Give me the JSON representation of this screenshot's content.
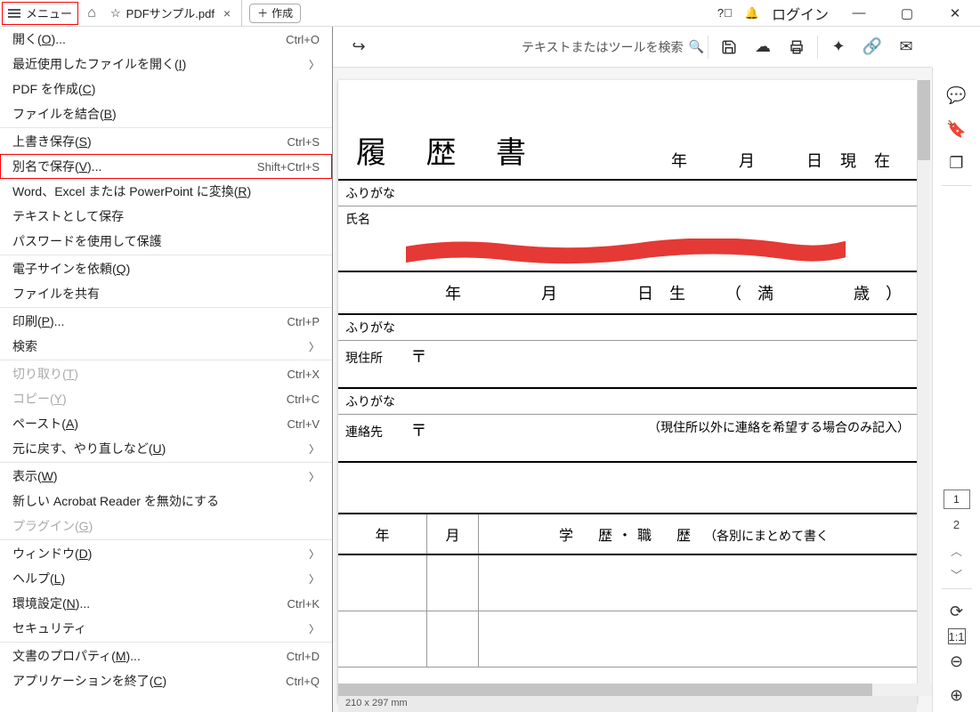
{
  "titlebar": {
    "menu": "メニュー",
    "tab_title": "PDFサンプル.pdf",
    "create": "作成",
    "login": "ログイン"
  },
  "callouts": {
    "one": "1",
    "two": "2"
  },
  "menu": {
    "open": "開く(O)...",
    "open_sc": "Ctrl+O",
    "recent": "最近使用したファイルを開く(I)",
    "create_pdf": "PDF を作成(C)",
    "combine": "ファイルを結合(B)",
    "save": "上書き保存(S)",
    "save_sc": "Ctrl+S",
    "saveas": "別名で保存(V)...",
    "saveas_sc": "Shift+Ctrl+S",
    "convert": "Word、Excel または PowerPoint に変換(R)",
    "savetext": "テキストとして保存",
    "protect": "パスワードを使用して保護",
    "esign": "電子サインを依頼(Q)",
    "share": "ファイルを共有",
    "print": "印刷(P)...",
    "print_sc": "Ctrl+P",
    "search": "検索",
    "cut": "切り取り(T)",
    "cut_sc": "Ctrl+X",
    "copy": "コピー(Y)",
    "copy_sc": "Ctrl+C",
    "paste": "ペースト(A)",
    "paste_sc": "Ctrl+V",
    "undo": "元に戻す、やり直しなど(U)",
    "view": "表示(W)",
    "disable": "新しい Acrobat Reader を無効にする",
    "plugin": "プラグイン(G)",
    "window": "ウィンドウ(D)",
    "help": "ヘルプ(L)",
    "prefs": "環境設定(N)...",
    "prefs_sc": "Ctrl+K",
    "security": "セキュリティ",
    "props": "文書のプロパティ(M)...",
    "props_sc": "Ctrl+D",
    "quit": "アプリケーションを終了(C)",
    "quit_sc": "Ctrl+Q"
  },
  "toolbar": {
    "search_placeholder": "テキストまたはツールを検索"
  },
  "document": {
    "title": "履 歴 書",
    "date_line": "年　月　日現在",
    "furigana": "ふりがな",
    "name": "氏名",
    "dob": "年　　月　　日生　（満　　歳）",
    "address": "現住所",
    "post": "〒",
    "contact": "連絡先",
    "contact_note": "（現住所以外に連絡を希望する場合のみ記入）",
    "year": "年",
    "month": "月",
    "history": "学　歴・職　歴",
    "history_note": "（各別にまとめて書く"
  },
  "rpanel": {
    "page_current": "1",
    "page_total": "2"
  },
  "status": {
    "dims": "210 x 297 mm"
  }
}
